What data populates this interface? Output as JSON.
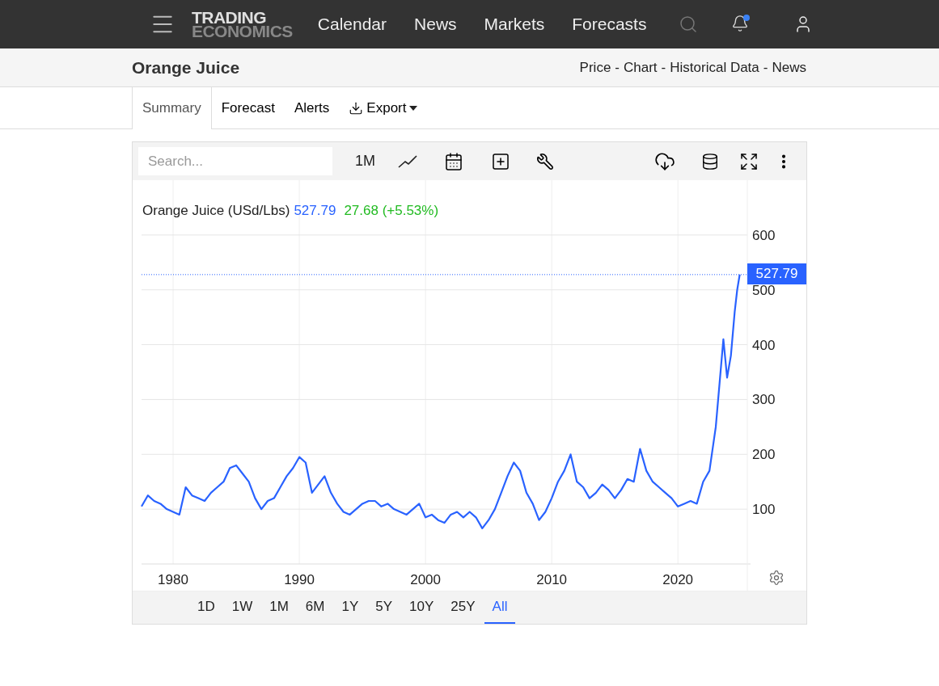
{
  "header": {
    "logo": {
      "line_1": "TRADING",
      "line_2": "ECONOMICS"
    },
    "nav": [
      "Calendar",
      "News",
      "Markets",
      "Forecasts"
    ],
    "notifications_unread": true
  },
  "page": {
    "title": "Orange Juice",
    "links": [
      {
        "label": "Price",
        "kind": "link"
      },
      {
        "label": "-",
        "kind": "separator"
      },
      {
        "label": "Chart",
        "kind": "link"
      },
      {
        "label": "-",
        "kind": "separator"
      },
      {
        "label": "Historical Data",
        "kind": "link"
      },
      {
        "label": "-",
        "kind": "separator"
      },
      {
        "label": "News",
        "kind": "link"
      }
    ]
  },
  "tabs": [
    {
      "label": "Summary",
      "selected": true,
      "kind": "tab"
    },
    {
      "label": "Forecast",
      "selected": false,
      "kind": "tab"
    },
    {
      "label": "Alerts",
      "selected": false,
      "kind": "tab"
    },
    {
      "label": "Export",
      "selected": false,
      "kind": "dropdown"
    }
  ],
  "chart_toolbar": {
    "search": {
      "placeholder": "Search..."
    },
    "period": "1M"
  },
  "legend": {
    "name": "Orange Juice (USd/Lbs)",
    "price": "527.79",
    "change": "27.68 (+5.53%)"
  },
  "chart_data": {
    "type": "line",
    "xticks": [
      1980,
      1990,
      2000,
      2010,
      2020
    ],
    "yticks": [
      100,
      200,
      300,
      400,
      500,
      600
    ],
    "xlim": [
      1977.5,
      2025.5
    ],
    "ylim": [
      0,
      700
    ],
    "grid": true,
    "ref_lines": [
      {
        "axis": "y",
        "value": 527.79,
        "label": "527.79"
      }
    ],
    "x": [
      1977.5,
      1978,
      1978.5,
      1979,
      1979.5,
      1980,
      1980.5,
      1981,
      1981.5,
      1982,
      1982.5,
      1983,
      1983.5,
      1984,
      1984.5,
      1985,
      1985.5,
      1986,
      1986.5,
      1987,
      1987.5,
      1988,
      1988.5,
      1989,
      1989.5,
      1990,
      1990.5,
      1991,
      1991.5,
      1992,
      1992.5,
      1993,
      1993.5,
      1994,
      1994.5,
      1995,
      1995.5,
      1996,
      1996.5,
      1997,
      1997.5,
      1998,
      1998.5,
      1999,
      1999.5,
      2000,
      2000.5,
      2001,
      2001.5,
      2002,
      2002.5,
      2003,
      2003.5,
      2004,
      2004.5,
      2005,
      2005.5,
      2006,
      2006.5,
      2007,
      2007.5,
      2008,
      2008.5,
      2009,
      2009.5,
      2010,
      2010.5,
      2011,
      2011.5,
      2012,
      2012.5,
      2013,
      2013.5,
      2014,
      2014.5,
      2015,
      2015.5,
      2016,
      2016.5,
      2017,
      2017.5,
      2018,
      2018.5,
      2019,
      2019.5,
      2020,
      2020.5,
      2021,
      2021.5,
      2022,
      2022.5,
      2023,
      2023.3,
      2023.6,
      2023.9,
      2024.2,
      2024.5,
      2024.7,
      2024.9
    ],
    "series": [
      {
        "color": "#2962ff",
        "values": [
          105,
          125,
          115,
          110,
          100,
          95,
          90,
          140,
          125,
          120,
          115,
          130,
          140,
          150,
          175,
          180,
          165,
          150,
          120,
          100,
          115,
          120,
          140,
          160,
          175,
          195,
          185,
          130,
          145,
          160,
          130,
          110,
          95,
          90,
          100,
          110,
          115,
          115,
          105,
          110,
          100,
          95,
          90,
          100,
          110,
          85,
          90,
          80,
          75,
          90,
          95,
          85,
          95,
          85,
          65,
          80,
          100,
          130,
          160,
          185,
          170,
          130,
          110,
          80,
          95,
          120,
          150,
          170,
          200,
          150,
          140,
          120,
          130,
          145,
          135,
          120,
          135,
          155,
          150,
          210,
          170,
          150,
          140,
          130,
          120,
          105,
          110,
          115,
          110,
          150,
          170,
          250,
          330,
          410,
          340,
          380,
          460,
          500,
          528
        ]
      }
    ]
  },
  "ranges": [
    {
      "label": "1D",
      "selected": false
    },
    {
      "label": "1W",
      "selected": false
    },
    {
      "label": "1M",
      "selected": false
    },
    {
      "label": "6M",
      "selected": false
    },
    {
      "label": "1Y",
      "selected": false
    },
    {
      "label": "5Y",
      "selected": false
    },
    {
      "label": "10Y",
      "selected": false
    },
    {
      "label": "25Y",
      "selected": false
    },
    {
      "label": "All",
      "selected": true
    }
  ]
}
